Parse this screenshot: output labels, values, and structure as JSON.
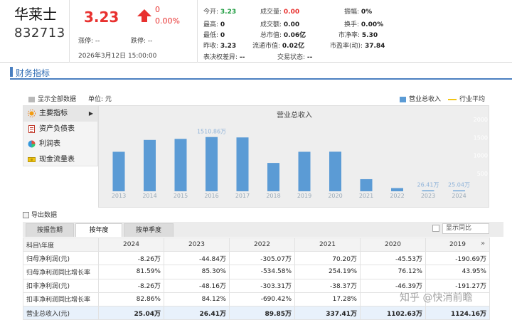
{
  "stock": {
    "name": "华莱士",
    "code": "832713"
  },
  "quote": {
    "price": "3.23",
    "change": "0",
    "change_pct": "0.00%",
    "limit_up_label": "涨停: --",
    "limit_down_label": "跌停: --",
    "timestamp": "2026年3月12日 15:00:00"
  },
  "stats": {
    "open_label": "今开:",
    "open": "3.23",
    "high_label": "最高:",
    "high": "0",
    "low_label": "最低:",
    "low": "0",
    "prev_close_label": "昨收:",
    "prev_close": "3.23",
    "diff_label": "表决权差异:",
    "diff": "--",
    "volume_label": "成交量:",
    "volume": "0.00",
    "amount_label": "成交额:",
    "amount": "0.00",
    "mcap_label": "总市值:",
    "mcap": "0.06亿",
    "float_mcap_label": "流通市值:",
    "float_mcap": "0.02亿",
    "trade_status_label": "交易状态:",
    "trade_status": "--",
    "amplitude_label": "振幅:",
    "amplitude": "0%",
    "turnover_label": "换手:",
    "turnover": "0.00%",
    "pb_label": "市净率:",
    "pb": "5.30",
    "pe_label": "市盈率(动):",
    "pe": "37.84"
  },
  "section": {
    "title": "财务指标",
    "show_all": "显示全部数据",
    "unit": "单位: 元",
    "legend_series": "营业总收入",
    "legend_avg": "行业平均"
  },
  "menu": [
    {
      "label": "主要指标",
      "icon": "sun-icon"
    },
    {
      "label": "资产负债表",
      "icon": "document-icon"
    },
    {
      "label": "利润表",
      "icon": "pie-icon"
    },
    {
      "label": "现金流量表",
      "icon": "cash-icon"
    }
  ],
  "chart_data": {
    "type": "bar",
    "title": "营业总收入",
    "categories": [
      "2013",
      "2014",
      "2015",
      "2016",
      "2017",
      "2018",
      "2019",
      "2020",
      "2021",
      "2022",
      "2023",
      "2024"
    ],
    "series": [
      {
        "name": "营业总收入",
        "values": [
          1100,
          1430,
          1460,
          1510.86,
          1500,
          790,
          1100,
          1102.63,
          337.41,
          89.85,
          26.41,
          25.04
        ]
      }
    ],
    "data_labels": {
      "3": "1510.86万",
      "10": "26.41万",
      "11": "25.04万"
    },
    "y_ticks": [
      "2000",
      "1500",
      "1000",
      "500"
    ],
    "ylim": [
      0,
      2000
    ],
    "bar_color": "#5b9bd5",
    "grid": false
  },
  "table": {
    "export_label": "导出数据",
    "tabs": [
      "按报告期",
      "按年度",
      "按单季度"
    ],
    "yoy_label": "显示同比",
    "more_icon": "»",
    "header": [
      "科目\\年度",
      "2024",
      "2023",
      "2022",
      "2021",
      "2020",
      "2019"
    ],
    "rows": [
      [
        "归母净利润(元)",
        "-8.26万",
        "-44.84万",
        "-305.07万",
        "70.20万",
        "-45.53万",
        "-190.69万"
      ],
      [
        "归母净利润同比增长率",
        "81.59%",
        "85.30%",
        "-534.58%",
        "254.19%",
        "76.12%",
        "43.95%"
      ],
      [
        "扣非净利润(元)",
        "-8.26万",
        "-48.16万",
        "-303.31万",
        "-38.37万",
        "-46.39万",
        "-191.27万"
      ],
      [
        "扣非净利润同比增长率",
        "82.86%",
        "84.12%",
        "-690.42%",
        "17.28%",
        "",
        ""
      ],
      [
        "营业总收入(元)",
        "25.04万",
        "26.41万",
        "89.85万",
        "337.41万",
        "1102.63万",
        "1124.16万"
      ]
    ]
  },
  "watermark": "知乎 @快消前瞻"
}
